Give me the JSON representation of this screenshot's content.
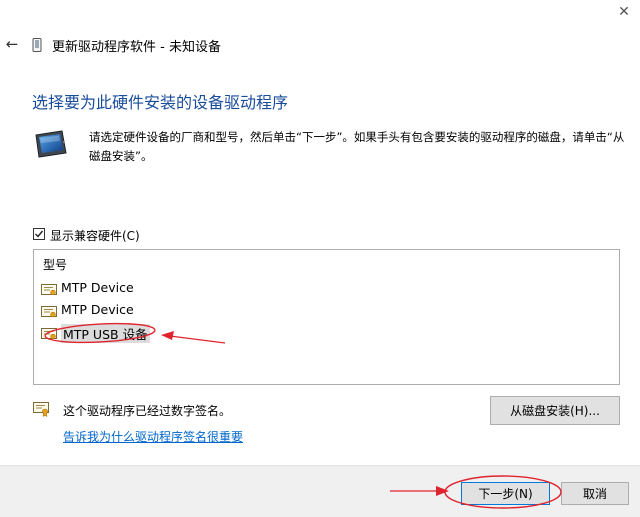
{
  "window": {
    "close_glyph": "✕",
    "back_glyph": "←",
    "title": "更新驱动程序软件 - 未知设备"
  },
  "main": {
    "heading": "选择要为此硬件安装的设备驱动程序",
    "instructions": "请选定硬件设备的厂商和型号，然后单击“下一步”。如果手头有包含要安装的驱动程序的磁盘，请单击“从磁盘安装”。"
  },
  "compat": {
    "checked": true,
    "label": "显示兼容硬件(C)"
  },
  "model_list": {
    "header": "型号",
    "items": [
      {
        "label": "MTP Device",
        "selected": false
      },
      {
        "label": "MTP Device",
        "selected": false
      },
      {
        "label": "MTP USB 设备",
        "selected": true
      }
    ]
  },
  "signature": {
    "status": "这个驱动程序已经过数字签名。",
    "link": "告诉我为什么驱动程序签名很重要"
  },
  "buttons": {
    "have_disk": "从磁盘安装(H)...",
    "next": "下一步(N)",
    "cancel": "取消"
  },
  "annotations": {
    "color": "#e0242e"
  }
}
